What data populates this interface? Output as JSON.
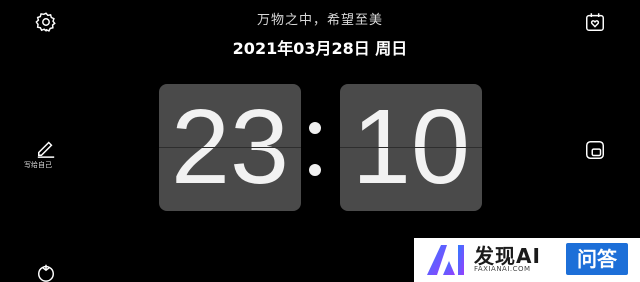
{
  "header": {
    "motto": "万物之中，希望至美",
    "date": "2021年03月28日 周日"
  },
  "clock": {
    "hours": "23",
    "minutes": "10"
  },
  "left_toolbar": {
    "settings_icon": "gear-icon",
    "write_label": "写给自己",
    "write_icon": "pencil-icon",
    "bottom_icon": "tomato-icon"
  },
  "right_toolbar": {
    "top_icon": "calendar-heart-icon",
    "middle_icon": "rotate-screen-icon"
  },
  "promo": {
    "title": "发现AI",
    "url": "FAXIANAI.COM",
    "button_label": "问答",
    "logo_icon": "ai-logo-icon"
  },
  "colors": {
    "background": "#000000",
    "card": "#4a4a4a",
    "digit": "#f2f2f2",
    "promo_blue": "#1d6fd8"
  }
}
